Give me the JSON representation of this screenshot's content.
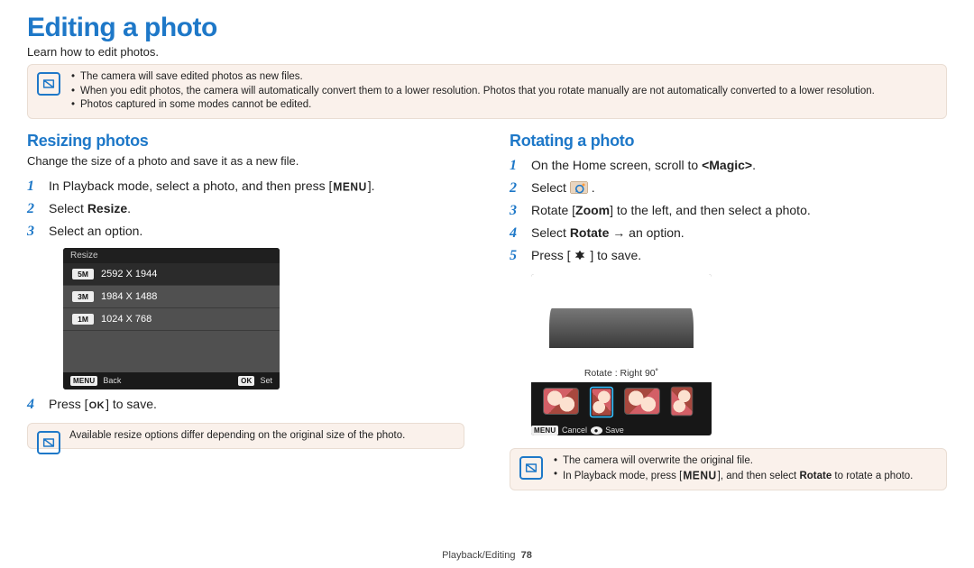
{
  "title": "Editing a photo",
  "subtitle": "Learn how to edit photos.",
  "top_infobox": {
    "bullets": [
      "The camera will save edited photos as new files.",
      "When you edit photos, the camera will automatically convert them to a lower resolution. Photos that you rotate manually are not automatically converted to a lower resolution.",
      "Photos captured in some modes cannot be edited."
    ]
  },
  "resize": {
    "heading": "Resizing photos",
    "sub": "Change the size of a photo and save it as a new file.",
    "menu_glyph": "MENU",
    "ok_glyph": "OK",
    "step1_pre": "In Playback mode, select a photo, and then press [",
    "step1_post": "].",
    "step2_pre": "Select ",
    "step2_strong": "Resize",
    "step2_post": ".",
    "step3": "Select an option.",
    "device": {
      "title": "Resize",
      "items": [
        {
          "mp": "5M",
          "dim": "2592 X 1944",
          "selected": true
        },
        {
          "mp": "3M",
          "dim": "1984 X 1488",
          "selected": false
        },
        {
          "mp": "1M",
          "dim": "1024 X 768",
          "selected": false
        }
      ],
      "foot": {
        "back_tag": "MENU",
        "back": "Back",
        "set_tag": "OK",
        "set": "Set"
      }
    },
    "step4_pre": "Press [",
    "step4_post": "] to save.",
    "note": "Available resize options differ depending on the original size of the photo."
  },
  "rotate": {
    "heading": "Rotating a photo",
    "step1_pre": "On the Home screen, scroll to ",
    "step1_strong": "<Magic>",
    "step1_post": ".",
    "step2_pre": "Select ",
    "step2_post": ".",
    "step3_pre": "Rotate [",
    "step3_strong": "Zoom",
    "step3_post": "] to the left, and then select a photo.",
    "step4_pre": "Select ",
    "step4_strong": "Rotate",
    "step4_post": " → an option.",
    "step5_pre": "Press [",
    "step5_post": "] to save.",
    "device": {
      "caption": "Rotate : Right 90˚",
      "foot": {
        "cancel_tag": "MENU",
        "cancel": "Cancel",
        "save_icon": "●",
        "save": "Save"
      }
    },
    "note_bullets": [
      "The camera will overwrite the original file."
    ],
    "note_combo": {
      "pre": "In Playback mode, press [",
      "menu": "MENU",
      "mid": "], and then select ",
      "strong": "Rotate",
      "post": " to rotate a photo."
    }
  },
  "footer": {
    "section": "Playback/Editing",
    "page": "78"
  }
}
